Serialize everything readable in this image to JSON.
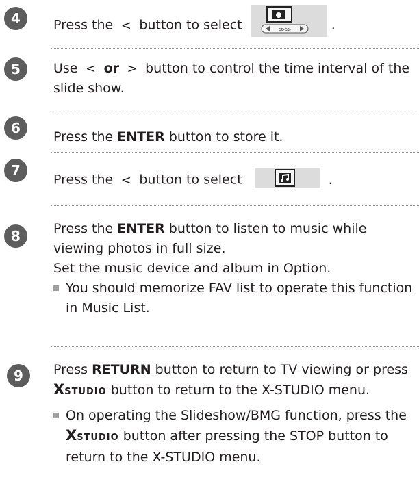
{
  "steps": [
    {
      "num": "4",
      "before": "Press the",
      "arrow": "<",
      "after": "button to select",
      "end": "."
    },
    {
      "num": "5",
      "pre": "Use",
      "left": "<",
      "mid": "or",
      "right": ">",
      "post": "button to control the time interval of the slide show."
    },
    {
      "num": "6",
      "pre": "Press the",
      "kw": "ENTER",
      "post": "button to store it."
    },
    {
      "num": "7",
      "before": "Press the",
      "arrow": "<",
      "after": "button to select",
      "end": "."
    },
    {
      "num": "8",
      "pre": "Press the",
      "kw": "ENTER",
      "post": "button to listen to music while viewing photos in full size.",
      "line2": "Set the music device and album in Option.",
      "note": "You should memorize FAV list to operate this function in Music List."
    },
    {
      "num": "9",
      "pre": "Press",
      "kw": "RETURN",
      "mid": "button to return to TV viewing or press",
      "logo": "XSTUDIO",
      "post": "button to return to the X-STUDIO menu.",
      "note_pre": "On operating the Slideshow/BMG function, press the",
      "note_logo": "XSTUDIO",
      "note_post": "button after pressing the STOP button to return to the X-STUDIO menu."
    }
  ],
  "logo": {
    "x": "X",
    "rest": "STUDIO"
  },
  "icons": {
    "slideshow": "slideshow-timer-icon",
    "music": "music-note-icon",
    "circle_color": "#5d5d5d"
  }
}
